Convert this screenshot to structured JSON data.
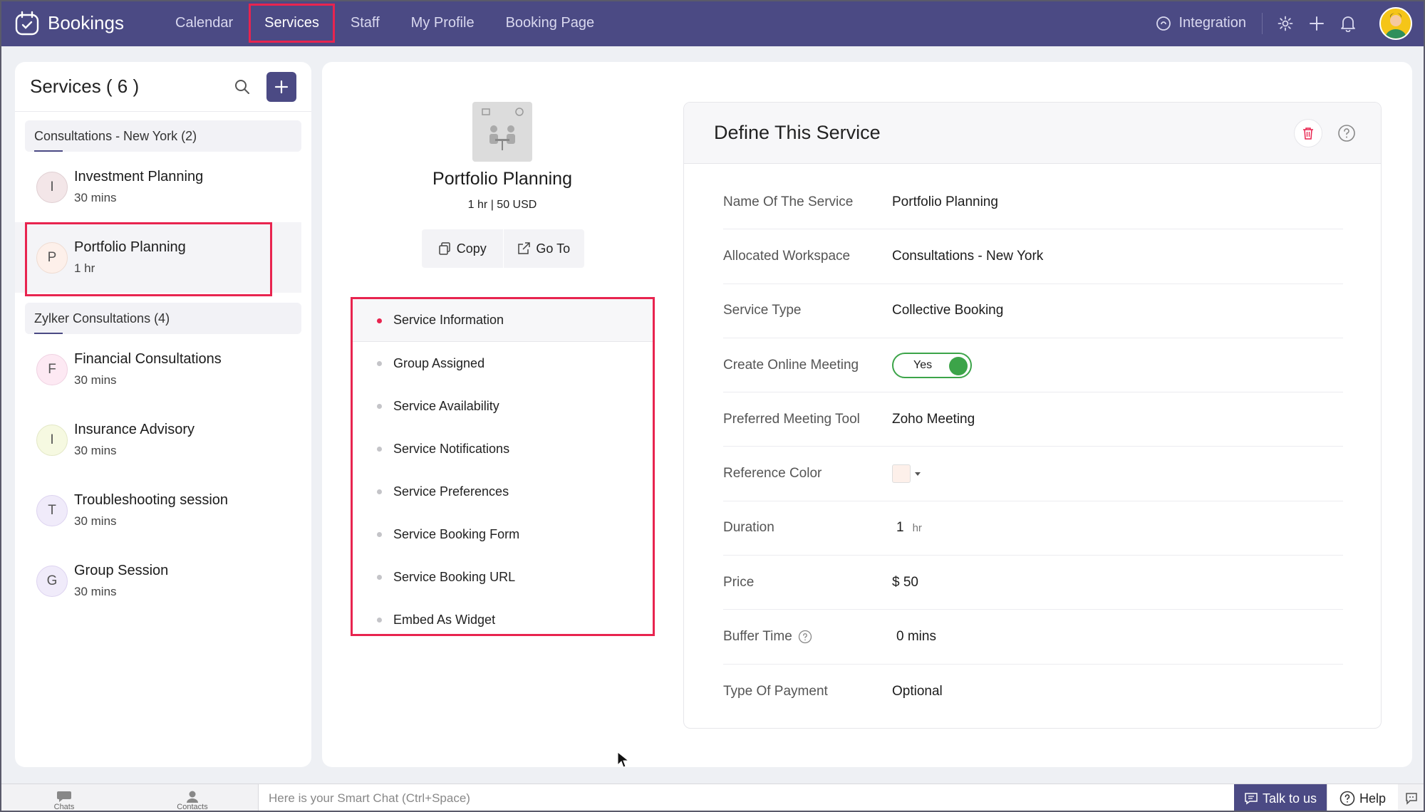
{
  "app": {
    "name": "Bookings"
  },
  "nav": {
    "items": [
      {
        "label": "Calendar"
      },
      {
        "label": "Services",
        "active": true
      },
      {
        "label": "Staff"
      },
      {
        "label": "My Profile"
      },
      {
        "label": "Booking Page"
      }
    ],
    "integration_label": "Integration"
  },
  "services_panel": {
    "title": "Services ( 6 )",
    "groups": [
      {
        "label": "Consultations - New York (2)",
        "services": [
          {
            "initial": "I",
            "name": "Investment Planning",
            "duration": "30 mins",
            "color": "#f3e6e8"
          },
          {
            "initial": "P",
            "name": "Portfolio Planning",
            "duration": "1 hr",
            "color": "#fdf0ea",
            "selected": true
          }
        ]
      },
      {
        "label": "Zylker Consultations (4)",
        "services": [
          {
            "initial": "F",
            "name": "Financial Consultations",
            "duration": "30 mins",
            "color": "#fde9f3"
          },
          {
            "initial": "I",
            "name": "Insurance Advisory",
            "duration": "30 mins",
            "color": "#f6f9e1"
          },
          {
            "initial": "T",
            "name": "Troubleshooting session",
            "duration": "30 mins",
            "color": "#f0ebfa"
          },
          {
            "initial": "G",
            "name": "Group Session",
            "duration": "30 mins",
            "color": "#f0ebfa"
          }
        ]
      }
    ]
  },
  "service_detail": {
    "title": "Portfolio Planning",
    "meta": "1 hr | 50 USD",
    "copy_label": "Copy",
    "goto_label": "Go To",
    "sections": [
      {
        "label": "Service Information",
        "active": true
      },
      {
        "label": "Group Assigned"
      },
      {
        "label": "Service Availability"
      },
      {
        "label": "Service Notifications"
      },
      {
        "label": "Service Preferences"
      },
      {
        "label": "Service Booking Form"
      },
      {
        "label": "Service Booking URL"
      },
      {
        "label": "Embed As Widget"
      }
    ]
  },
  "define": {
    "title": "Define This Service",
    "fields": {
      "name_label": "Name Of The Service",
      "name_value": "Portfolio Planning",
      "workspace_label": "Allocated Workspace",
      "workspace_value": "Consultations - New York",
      "type_label": "Service Type",
      "type_value": "Collective Booking",
      "online_label": "Create Online Meeting",
      "online_value": "Yes",
      "tool_label": "Preferred Meeting Tool",
      "tool_value": "Zoho Meeting",
      "color_label": "Reference Color",
      "color_value": "#fdf0ea",
      "duration_label": "Duration",
      "duration_value": "1",
      "duration_unit": "hr",
      "price_label": "Price",
      "price_value": "$ 50",
      "buffer_label": "Buffer Time",
      "buffer_value": "0 mins",
      "payment_label": "Type Of Payment",
      "payment_value": "Optional"
    }
  },
  "bottom": {
    "chats": "Chats",
    "contacts": "Contacts",
    "smart_chat_placeholder": "Here is your Smart Chat (Ctrl+Space)",
    "talk": "Talk to us",
    "help": "Help"
  },
  "colors": {
    "brand": "#4b4a84",
    "highlight": "#e8244f",
    "toggle_on": "#3ca449"
  }
}
